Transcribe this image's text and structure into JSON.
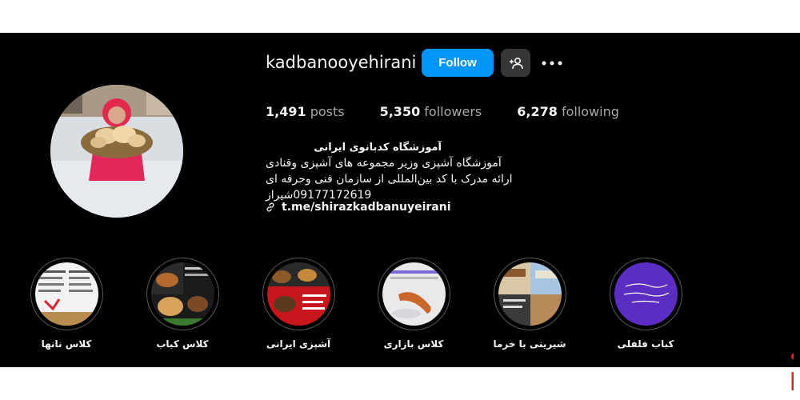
{
  "profile": {
    "username": "kadbanooyehirani",
    "follow_label": "Follow",
    "stats": [
      {
        "value": "1,491",
        "label": "posts"
      },
      {
        "value": "5,350",
        "label": "followers"
      },
      {
        "value": "6,278",
        "label": "following"
      }
    ],
    "bio_name": "آموزشگاه کدبانوی ایرانی",
    "bio_lines": [
      "آموزشگاه آشپزی وزیر مجموعه های آشپزی وقنادی",
      "ارائه مدرک با کد بین‌المللی از سازمان فنی وحرفه ای",
      "09177172619شیراز"
    ],
    "link": "t.me/shirazkadbanuyeirani"
  },
  "highlights": [
    {
      "label": "کلاس نانها"
    },
    {
      "label": "کلاس کباب"
    },
    {
      "label": "آشپزی ایرانی"
    },
    {
      "label": "کلاس بازاری"
    },
    {
      "label": "شیرینی با خرما"
    },
    {
      "label": "کباب فلفلی"
    }
  ],
  "watermark": {
    "line1": "کافه",
    "line2": "کارا",
    "color": "#e8221b"
  },
  "colors": {
    "accent": "#0095f6",
    "background": "#000000"
  },
  "icons": {
    "suggest": "person-add-icon",
    "more": "more-horizontal-icon",
    "link": "link-icon"
  }
}
